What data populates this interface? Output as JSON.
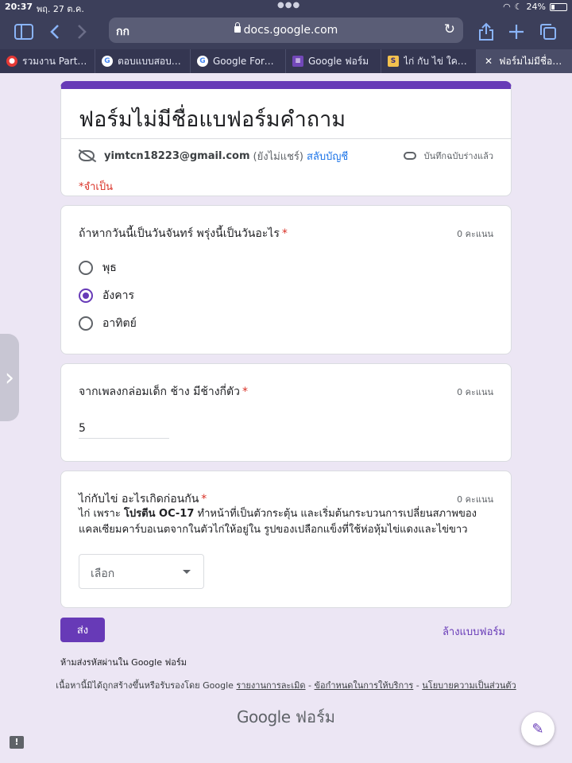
{
  "status_bar": {
    "time": "20:37",
    "date": "พฤ. 27 ต.ค.",
    "battery_text": "24%",
    "battery_level": 0.24
  },
  "browser": {
    "address_prefix": "กก",
    "url": "docs.google.com",
    "tabs": [
      {
        "label": "รวมงาน Part T...",
        "icon": "red-app-icon",
        "active": false
      },
      {
        "label": "ตอบแบบสอบถ...",
        "icon": "google-g-icon",
        "active": false
      },
      {
        "label": "Google Form...",
        "icon": "google-g-icon",
        "active": false
      },
      {
        "label": "Google ฟอร์ม",
        "icon": "google-forms-icon",
        "active": false
      },
      {
        "label": "ไก่ กับ ไข่ ใครเ...",
        "icon": "site-icon",
        "active": false
      },
      {
        "label": "ฟอร์มไม่มีชื่อแ...",
        "icon": "close-icon",
        "active": true
      }
    ]
  },
  "form": {
    "title": "ฟอร์มไม่มีชื่อแบฟอร์มคำถาม",
    "account_email": "yimtcn18223@gmail.com",
    "account_note": "(ยังไม่แชร์)",
    "switch_account": "สลับบัญชี",
    "saved_status": "บันทึกฉบับร่างแล้ว",
    "required_note": "*จำเป็น",
    "questions": [
      {
        "title": "ถ้าหากวันนี้เป็นวันจันทร์ พรุ่งนี้เป็นวันอะไร",
        "required": "*",
        "points": "0 คะแนน",
        "options": [
          {
            "label": "พุธ",
            "selected": false
          },
          {
            "label": "อังคาร",
            "selected": true
          },
          {
            "label": "อาทิตย์",
            "selected": false
          }
        ]
      },
      {
        "title": "จากเพลงกล่อมเด็ก ช้าง มีช้างกี่ตัว",
        "required": "*",
        "points": "0 คะแนน",
        "answer": "5"
      },
      {
        "title": "ไก่กับไข่ อะไรเกิดก่อนกัน",
        "required": "*",
        "points": "0 คะแนน",
        "desc_pre": "ไก่ เพราะ ",
        "desc_bold": "โปรตีน OC-17",
        "desc_post": " ทำหน้าที่เป็นตัวกระตุ้น และเริ่มต้นกระบวนการเปลี่ยนสภาพของแคลเซียมคาร์บอเนตจากในตัวไก่ให้อยู่ใน รูปของเปลือกแข็งที่ใช้ห่อหุ้มไข่แดงและไข่ขาว",
        "dropdown_placeholder": "เลือก"
      }
    ],
    "submit_label": "ส่ง",
    "clear_label": "ล้างแบบฟอร์ม"
  },
  "footer": {
    "never_submit": "ห้ามส่งรหัสผ่านใน Google ฟอร์ม",
    "disclaimer_pre": "เนื้อหานี้มิได้ถูกสร้างขึ้นหรือรับรองโดย Google",
    "link_abuse": "รายงานการละเมิด",
    "sep": " - ",
    "link_terms": "ข้อกำหนดในการให้บริการ",
    "link_privacy": "นโยบายความเป็นส่วนตัว",
    "brand_google": "Google",
    "brand_forms": "ฟอร์ม"
  }
}
